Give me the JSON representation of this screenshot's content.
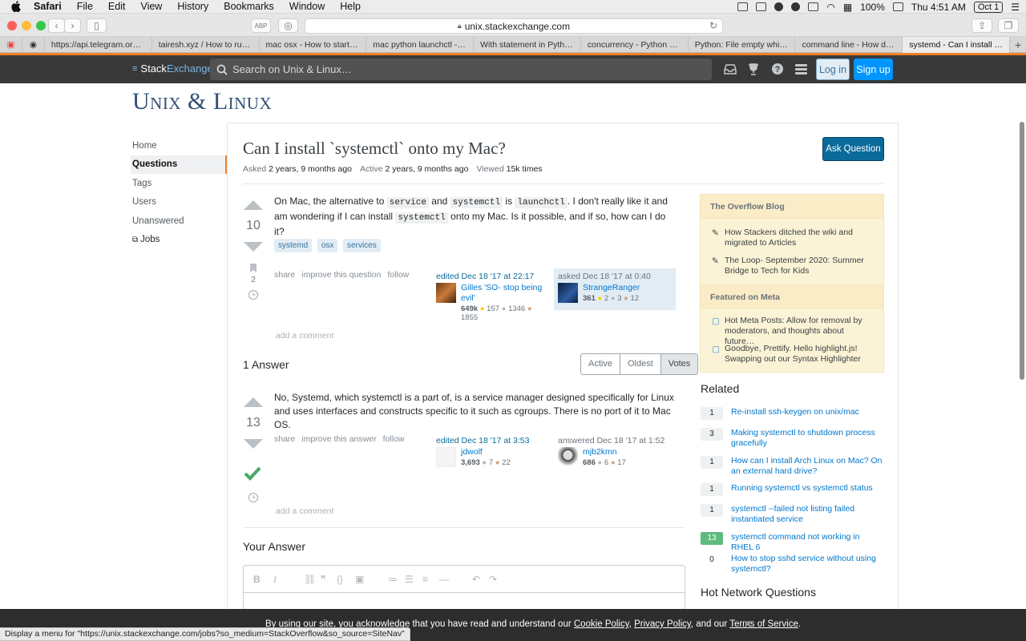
{
  "menubar": {
    "app": "Safari",
    "items": [
      "File",
      "Edit",
      "View",
      "History",
      "Bookmarks",
      "Window",
      "Help"
    ],
    "battery": "100%",
    "clock": "Thu 4:51 AM",
    "date_badge": "Oct 1"
  },
  "toolbar": {
    "url": "unix.stackexchange.com"
  },
  "tabs": [
    {
      "label": "https://api.telegram.org/b..."
    },
    {
      "label": "tairesh.xyz / How to run py..."
    },
    {
      "label": "mac osx - How to start/sto..."
    },
    {
      "label": "mac python launchctl - Go..."
    },
    {
      "label": "With statement in Python..."
    },
    {
      "label": "concurrency - Python Mul..."
    },
    {
      "label": "Python: File empty while s..."
    },
    {
      "label": "command line - How do I..."
    },
    {
      "label": "systemd - Can I install `sy..."
    }
  ],
  "topbar": {
    "logo_stack": "Stack",
    "logo_exchange": "Exchange",
    "search_placeholder": "Search on Unix & Linux…",
    "login": "Log in",
    "signup": "Sign up"
  },
  "site": {
    "logo": "Unix & Linux"
  },
  "nav": {
    "home": "Home",
    "questions": "Questions",
    "tags": "Tags",
    "users": "Users",
    "unanswered": "Unanswered",
    "jobs": "Jobs"
  },
  "question": {
    "title": "Can I install `systemctl` onto my Mac?",
    "ask_button": "Ask Question",
    "asked_label": "Asked",
    "asked_value": "2 years, 9 months ago",
    "active_label": "Active",
    "active_value": "2 years, 9 months ago",
    "viewed_label": "Viewed",
    "viewed_value": "15k times",
    "votes": "10",
    "bookmarks": "2",
    "body_1": "On Mac, the alternative to ",
    "code_1": "service",
    "body_2": " and ",
    "code_2": "systemctl",
    "body_3": " is ",
    "code_3": "launchctl",
    "body_4": ". I don't really like it and am wondering if I can install ",
    "code_4": "systemctl",
    "body_5": " onto my Mac. Is it possible, and if so, how can I do it?",
    "tags": [
      "systemd",
      "osx",
      "services"
    ],
    "actions": [
      "share",
      "improve this question",
      "follow"
    ],
    "edited": {
      "label": "edited Dec 18 '17 at 22:17",
      "name": "Gilles 'SO- stop being evil'",
      "rep": "649k",
      "gold": "157",
      "silver": "1346",
      "bronze": "1855"
    },
    "asked": {
      "label": "asked Dec 18 '17 at 0:40",
      "name": "StrangeRanger",
      "rep": "361",
      "gold": "2",
      "silver": "3",
      "bronze": "12"
    },
    "add_comment": "add a comment"
  },
  "answers": {
    "count": "1 Answer",
    "sort": [
      "Active",
      "Oldest",
      "Votes"
    ]
  },
  "answer": {
    "votes": "13",
    "body": "No, Systemd, which systemctl is a part of, is a service manager designed specifically for Linux and uses interfaces and constructs specific to it such as cgroups. There is no port of it to Mac OS.",
    "actions": [
      "share",
      "improve this answer",
      "follow"
    ],
    "edited": {
      "label": "edited Dec 18 '17 at 3:53",
      "name": "jdwolf",
      "rep": "3,693",
      "silver": "7",
      "bronze": "22"
    },
    "answered": {
      "label": "answered Dec 18 '17 at 1:52",
      "name": "mjb2kmn",
      "rep": "686",
      "silver": "6",
      "bronze": "17"
    },
    "add_comment": "add a comment"
  },
  "your_answer": "Your Answer",
  "sidebar": {
    "blog_title": "The Overflow Blog",
    "blog_items": [
      "How Stackers ditched the wiki and migrated to Articles",
      "The Loop- September 2020: Summer Bridge to Tech for Kids"
    ],
    "meta_title": "Featured on Meta",
    "meta_items": [
      "Hot Meta Posts: Allow for removal by moderators, and thoughts about future…",
      "Goodbye, Prettify. Hello highlight.js! Swapping out our Syntax Highlighter"
    ],
    "related_title": "Related",
    "related": [
      {
        "count": "1",
        "title": "Re-install ssh-keygen on unix/mac"
      },
      {
        "count": "3",
        "title": "Making systemctl to shutdown process gracefully"
      },
      {
        "count": "1",
        "title": "How can I install Arch Linux on Mac? On an external hard drive?"
      },
      {
        "count": "1",
        "title": "Running systemctl vs systemctl status"
      },
      {
        "count": "1",
        "title": "systemctl --failed not listing failed instantiated service"
      },
      {
        "count": "13",
        "title": "systemctl command not working in RHEL 6"
      },
      {
        "count": "0",
        "title": "How to stop sshd service without using systemctl?"
      }
    ],
    "hot_title": "Hot Network Questions"
  },
  "cookie": {
    "prefix": "By using our site, you acknowledge that you have read and understand our ",
    "cookie_policy": "Cookie Policy",
    "sep": ", ",
    "privacy_policy": "Privacy Policy",
    "and": ", and our ",
    "terms": "Terms of Service",
    "suffix": "."
  },
  "status_text": "Display a menu for \"https://unix.stackexchange.com/jobs?so_medium=StackOverflow&so_source=SiteNav\"",
  "colors": {
    "accent": "#f48024",
    "link": "#0077cc",
    "primary_button": "#0a6b9b",
    "accepted": "#5eba7d"
  }
}
